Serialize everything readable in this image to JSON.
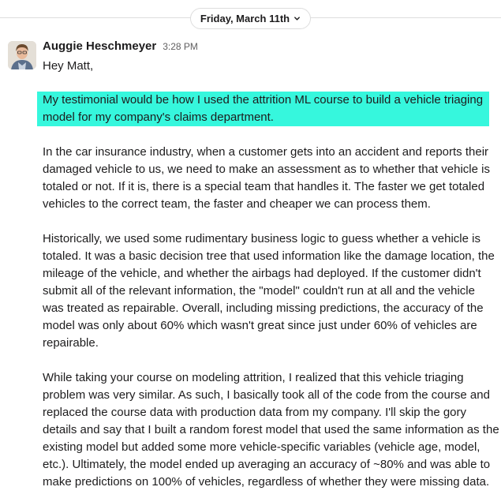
{
  "date_divider": {
    "label": "Friday, March 11th",
    "icon": "chevron-down-icon"
  },
  "message": {
    "sender": "Auggie Heschmeyer",
    "time": "3:28 PM",
    "avatar_icon": "user-avatar",
    "greeting": "Hey Matt,",
    "highlighted": {
      "color": "#36f7dd",
      "lines": [
        "My testimonial would be how I used the attrition ML course to build a vehicle triaging",
        "model for my company's claims department."
      ]
    },
    "paragraph1": [
      "In the car insurance industry, when a customer gets into an accident and reports their",
      "damaged vehicle to us, we need to make an assessment as to whether that vehicle is",
      "totaled or not. If it is, there is a special team that handles it. The faster we get totaled",
      "vehicles to the correct team, the faster and cheaper we can process them."
    ],
    "paragraph2": [
      "Historically, we used some rudimentary business logic to guess whether a vehicle is",
      "totaled. It was a basic decision tree that used information like the damage location, the",
      "mileage of the vehicle, and whether the airbags had deployed. If the customer didn't",
      "submit all of the relevant information, the \"model\" couldn't run at all and the vehicle",
      "was treated as repairable. Overall, including missing predictions, the accuracy of the",
      "model was only about 60% which wasn't great since just under 60% of vehicles are",
      "repairable."
    ],
    "paragraph3": [
      "While taking your course on modeling attrition, I realized that this vehicle triaging",
      "problem was very similar. As such, I basically took all of the code from the course and",
      "replaced the course data with production data from my company. I'll skip the gory",
      "details and say that I built a random forest model that used the same information as the",
      "existing model but added some more vehicle-specific variables (vehicle age, model,",
      "etc.). Ultimately, the model ended up averaging an accuracy of ~80% and was able to",
      "make predictions on 100% of vehicles, regardless of whether they were missing data."
    ]
  }
}
